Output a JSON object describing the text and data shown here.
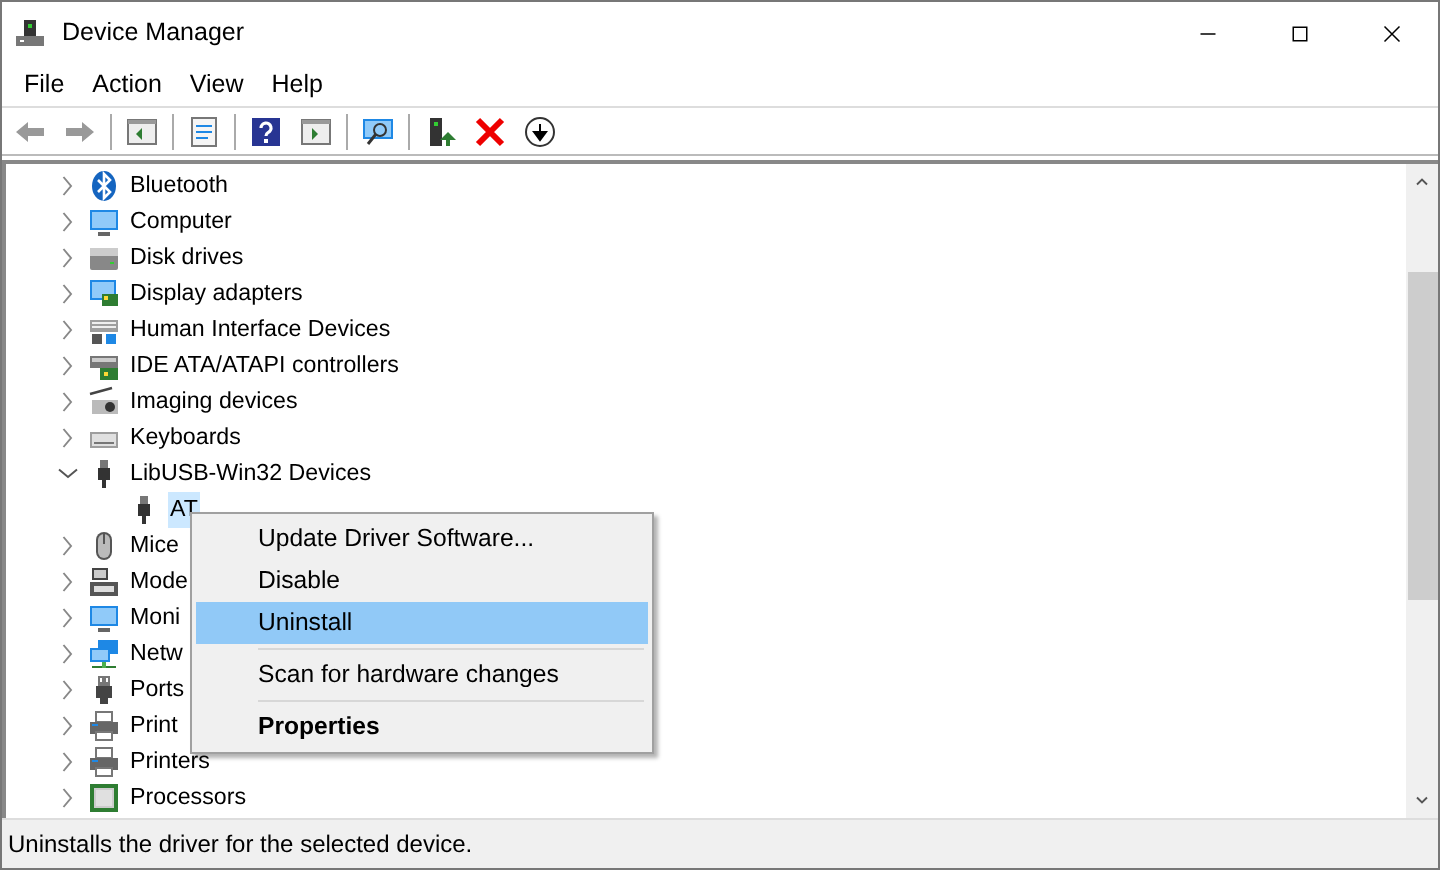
{
  "window": {
    "title": "Device Manager"
  },
  "menu_bar": [
    "File",
    "Action",
    "View",
    "Help"
  ],
  "tree": [
    {
      "label": "Bluetooth",
      "expanded": false
    },
    {
      "label": "Computer",
      "expanded": false
    },
    {
      "label": "Disk drives",
      "expanded": false
    },
    {
      "label": "Display adapters",
      "expanded": false
    },
    {
      "label": "Human Interface Devices",
      "expanded": false
    },
    {
      "label": "IDE ATA/ATAPI controllers",
      "expanded": false
    },
    {
      "label": "Imaging devices",
      "expanded": false
    },
    {
      "label": "Keyboards",
      "expanded": false
    },
    {
      "label": "LibUSB-Win32 Devices",
      "expanded": true,
      "children": [
        {
          "label": "AT",
          "selected": true
        }
      ]
    },
    {
      "label": "Mice",
      "expanded": false
    },
    {
      "label": "Mode",
      "expanded": false
    },
    {
      "label": "Moni",
      "expanded": false
    },
    {
      "label": "Netw",
      "expanded": false
    },
    {
      "label": "Ports",
      "expanded": false
    },
    {
      "label": "Print",
      "expanded": false
    },
    {
      "label": "Printers",
      "expanded": false
    },
    {
      "label": "Processors",
      "expanded": false
    }
  ],
  "context_menu": [
    {
      "label": "Update Driver Software...",
      "kind": "item",
      "selected": false
    },
    {
      "label": "Disable",
      "kind": "item",
      "selected": false
    },
    {
      "label": "Uninstall",
      "kind": "item",
      "selected": true
    },
    {
      "kind": "separator"
    },
    {
      "label": "Scan for hardware changes",
      "kind": "item",
      "selected": false
    },
    {
      "kind": "separator"
    },
    {
      "label": "Properties",
      "kind": "default",
      "selected": false
    }
  ],
  "status_bar": "Uninstalls the driver for the selected device."
}
